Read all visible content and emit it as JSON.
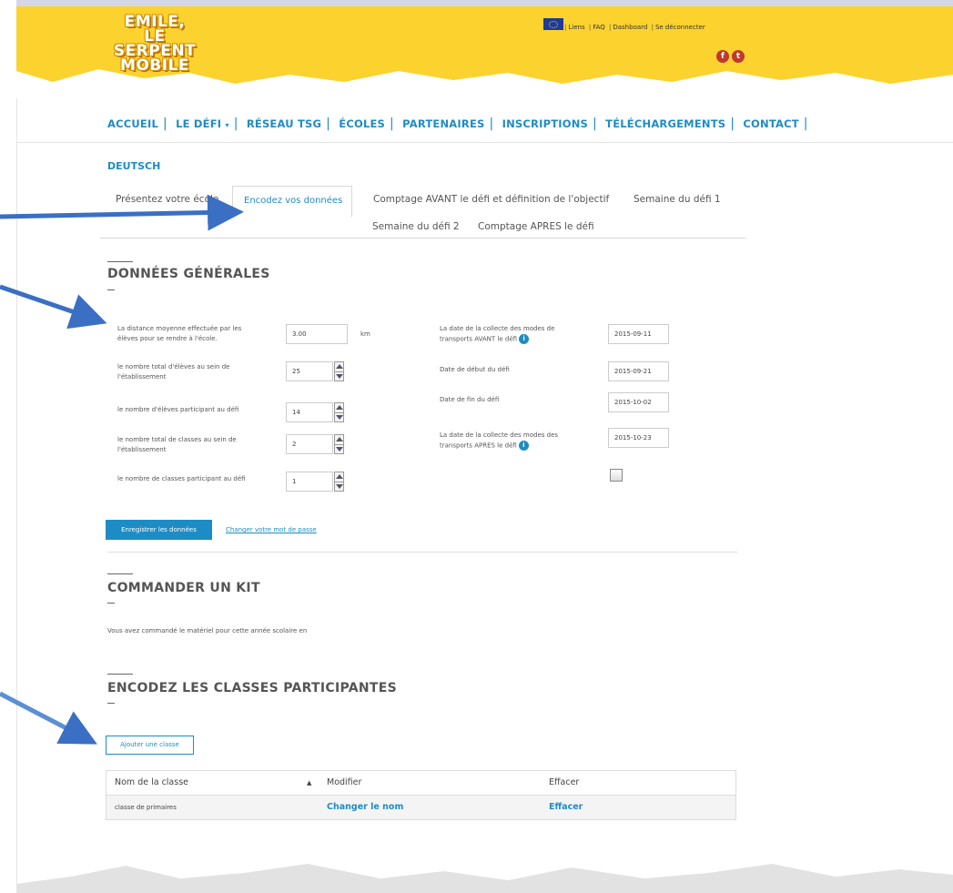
{
  "header": {
    "logo_line1": "EMILE,",
    "logo_line2": "LE SERPENT",
    "logo_line3": "MOBILE",
    "links": [
      "Liens",
      "FAQ",
      "Dashboard",
      "Se déconnecter"
    ],
    "social": [
      "facebook-icon",
      "twitter-icon"
    ]
  },
  "nav": {
    "items": [
      "ACCUEIL",
      "LE DÉFI",
      "RÉSEAU TSG",
      "ÉCOLES",
      "PARTENAIRES",
      "INSCRIPTIONS",
      "TÉLÉCHARGEMENTS",
      "CONTACT"
    ],
    "language": "DEUTSCH"
  },
  "tabs": {
    "t1": "Présentez votre école",
    "t2": "Encodez vos données",
    "t3": "Comptage AVANT le défi et définition de l'objectif",
    "t4": "Semaine du défi 1",
    "t5": "Semaine du défi 2",
    "t6": "Comptage APRES le défi",
    "active": "Encodez vos données"
  },
  "general": {
    "title": "DONNÉES GÉNÉRALES",
    "distance_label_1": "La distance moyenne effectuée par les",
    "distance_label_2": "élèves pour se rendre à l'école.",
    "distance_value": "3.00",
    "distance_unit": "km",
    "students_total_label_1": "le nombre total d'élèves au sein de",
    "students_total_label_2": "l'établissement",
    "students_total_value": "25",
    "students_part_label": "le nombre d'élèves participant au défi",
    "students_part_value": "14",
    "classes_total_label_1": "le nombre total de classes au sein de",
    "classes_total_label_2": "l'établissement",
    "classes_total_value": "2",
    "classes_part_label": "le nombre de classes participant au défi",
    "classes_part_value": "1",
    "date_before_label_1": "La date de la collecte des modes de",
    "date_before_label_2": "transports AVANT le défi",
    "date_before_value": "2015-09-11",
    "date_start_label": "Date de début du défi",
    "date_start_value": "2015-09-21",
    "date_end_label": "Date de fin du défi",
    "date_end_value": "2015-10-02",
    "date_after_label_1": "La date de la collecte des modes des",
    "date_after_label_2": "transports APRES le défi",
    "date_after_value": "2015-10-23",
    "save_button": "Enregistrer les données",
    "change_password": "Changer votre mot de passe"
  },
  "kit": {
    "title": "COMMANDER UN KIT",
    "text": "Vous avez commandé le matériel pour cette année scolaire en"
  },
  "classes": {
    "title": "ENCODEZ LES CLASSES PARTICIPANTES",
    "add_button": "Ajouter une classe",
    "columns": [
      "Nom de la classe",
      "Modifier",
      "Effacer"
    ],
    "rows": [
      {
        "name": "classe de primaires",
        "edit": "Changer le nom",
        "delete": "Effacer"
      }
    ]
  },
  "colors": {
    "brand_yellow": "#fcd22e",
    "accent_blue": "#1e8cc4",
    "arrow_blue": "#3a6fc4"
  }
}
